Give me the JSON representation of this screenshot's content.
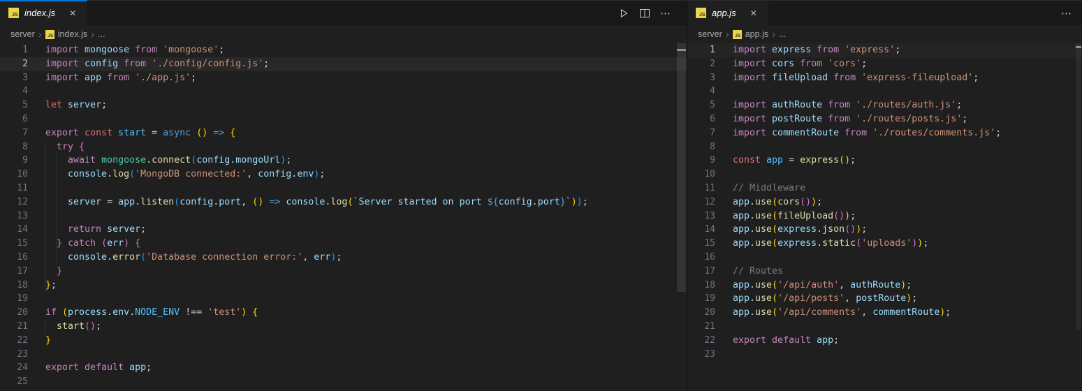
{
  "palette": {
    "kp": "#C586C0",
    "kw": "#569CD6",
    "st": "#E06C75",
    "vr": "#9CDCFE",
    "ct": "#4FC1FF",
    "cl": "#4EC9B0",
    "fn": "#DCDCAA",
    "sr": "#CE9178",
    "ts": "#9CDCFE",
    "te": "#569CD6",
    "cm": "#7B7B7B",
    "pn": "#D4D4D4",
    "b1": "#FFD700",
    "b2": "#DA70D6",
    "b3": "#179FFF"
  },
  "ui": {
    "accent": "#0078D4",
    "editor_bg": "#1F1F1F",
    "tabbar_bg": "#181818",
    "line_highlight_left": "#282828",
    "line_highlight_right": "#242424"
  },
  "icons": {
    "js_badge": "JS",
    "close": "✕",
    "more": "⋯",
    "breadcrumb_sep": "›"
  },
  "left": {
    "tab": {
      "label": "index.js"
    },
    "breadcrumb": [
      {
        "label": "server"
      },
      {
        "label": "index.js",
        "js": true
      },
      {
        "label": "..."
      }
    ],
    "active_line": 2,
    "lines": [
      [
        [
          "kp",
          "import"
        ],
        [
          "vr",
          " mongoose"
        ],
        [
          "kp",
          " from"
        ],
        [
          "sr",
          " 'mongoose'"
        ],
        [
          "pn",
          ";"
        ]
      ],
      [
        [
          "kp",
          "import"
        ],
        [
          "vr",
          " config"
        ],
        [
          "kp",
          " from"
        ],
        [
          "sr",
          " './config/config.js'"
        ],
        [
          "pn",
          ";"
        ]
      ],
      [
        [
          "kp",
          "import"
        ],
        [
          "vr",
          " app"
        ],
        [
          "kp",
          " from"
        ],
        [
          "sr",
          " './app.js'"
        ],
        [
          "pn",
          ";"
        ]
      ],
      [],
      [
        [
          "st",
          "let"
        ],
        [
          "vr",
          " server"
        ],
        [
          "pn",
          ";"
        ]
      ],
      [],
      [
        [
          "kp",
          "export"
        ],
        [
          "st",
          " const"
        ],
        [
          "ct",
          " start"
        ],
        [
          "pn",
          " ="
        ],
        [
          "kw",
          " async"
        ],
        [
          "b1",
          " ()"
        ],
        [
          "kw",
          " =>"
        ],
        [
          "b1",
          " {"
        ]
      ],
      [
        [
          "kp",
          "  try"
        ],
        [
          "b2",
          " {"
        ]
      ],
      [
        [
          "kp",
          "    await"
        ],
        [
          "cl",
          " mongoose"
        ],
        [
          "pn",
          "."
        ],
        [
          "fn",
          "connect"
        ],
        [
          "b3",
          "("
        ],
        [
          "vr",
          "config"
        ],
        [
          "pn",
          "."
        ],
        [
          "vr",
          "mongoUrl"
        ],
        [
          "b3",
          ")"
        ],
        [
          "pn",
          ";"
        ]
      ],
      [
        [
          "vr",
          "    console"
        ],
        [
          "pn",
          "."
        ],
        [
          "fn",
          "log"
        ],
        [
          "b3",
          "("
        ],
        [
          "sr",
          "'MongoDB connected:'"
        ],
        [
          "pn",
          ","
        ],
        [
          "vr",
          " config"
        ],
        [
          "pn",
          "."
        ],
        [
          "vr",
          "env"
        ],
        [
          "b3",
          ")"
        ],
        [
          "pn",
          ";"
        ]
      ],
      [],
      [
        [
          "vr",
          "    server"
        ],
        [
          "pn",
          " ="
        ],
        [
          "vr",
          " app"
        ],
        [
          "pn",
          "."
        ],
        [
          "fn",
          "listen"
        ],
        [
          "b3",
          "("
        ],
        [
          "vr",
          "config"
        ],
        [
          "pn",
          "."
        ],
        [
          "vr",
          "port"
        ],
        [
          "pn",
          ","
        ],
        [
          "b1",
          " ()"
        ],
        [
          "kw",
          " =>"
        ],
        [
          "vr",
          " console"
        ],
        [
          "pn",
          "."
        ],
        [
          "fn",
          "log"
        ],
        [
          "b1",
          "("
        ],
        [
          "ts",
          "`Server started on port "
        ],
        [
          "te",
          "${"
        ],
        [
          "vr",
          "config"
        ],
        [
          "pn",
          "."
        ],
        [
          "vr",
          "port"
        ],
        [
          "te",
          "}"
        ],
        [
          "ts",
          "`"
        ],
        [
          "b1",
          ")"
        ],
        [
          "b3",
          ")"
        ],
        [
          "pn",
          ";"
        ]
      ],
      [],
      [
        [
          "kp",
          "    return"
        ],
        [
          "vr",
          " server"
        ],
        [
          "pn",
          ";"
        ]
      ],
      [
        [
          "b2",
          "  }"
        ],
        [
          "kp",
          " catch"
        ],
        [
          "b2",
          " ("
        ],
        [
          "vr",
          "err"
        ],
        [
          "b2",
          ")"
        ],
        [
          "b2",
          " {"
        ]
      ],
      [
        [
          "vr",
          "    console"
        ],
        [
          "pn",
          "."
        ],
        [
          "fn",
          "error"
        ],
        [
          "b3",
          "("
        ],
        [
          "sr",
          "'Database connection error:'"
        ],
        [
          "pn",
          ","
        ],
        [
          "vr",
          " err"
        ],
        [
          "b3",
          ")"
        ],
        [
          "pn",
          ";"
        ]
      ],
      [
        [
          "b2",
          "  }"
        ]
      ],
      [
        [
          "b1",
          "}"
        ],
        [
          "pn",
          ";"
        ]
      ],
      [],
      [
        [
          "kp",
          "if"
        ],
        [
          "b1",
          " ("
        ],
        [
          "vr",
          "process"
        ],
        [
          "pn",
          "."
        ],
        [
          "vr",
          "env"
        ],
        [
          "pn",
          "."
        ],
        [
          "ct",
          "NODE_ENV"
        ],
        [
          "pn",
          " !=="
        ],
        [
          "sr",
          " 'test'"
        ],
        [
          "b1",
          ")"
        ],
        [
          "b1",
          " {"
        ]
      ],
      [
        [
          "fn",
          "  start"
        ],
        [
          "b2",
          "()"
        ],
        [
          "pn",
          ";"
        ]
      ],
      [
        [
          "b1",
          "}"
        ]
      ],
      [],
      [
        [
          "kp",
          "export"
        ],
        [
          "kp",
          " default"
        ],
        [
          "vr",
          " app"
        ],
        [
          "pn",
          ";"
        ]
      ],
      []
    ]
  },
  "right": {
    "tab": {
      "label": "app.js"
    },
    "breadcrumb": [
      {
        "label": "server"
      },
      {
        "label": "app.js",
        "js": true
      },
      {
        "label": "..."
      }
    ],
    "active_line": 1,
    "lines": [
      [
        [
          "kp",
          "import"
        ],
        [
          "vr",
          " express"
        ],
        [
          "kp",
          " from"
        ],
        [
          "sr",
          " 'express'"
        ],
        [
          "pn",
          ";"
        ]
      ],
      [
        [
          "kp",
          "import"
        ],
        [
          "vr",
          " cors"
        ],
        [
          "kp",
          " from"
        ],
        [
          "sr",
          " 'cors'"
        ],
        [
          "pn",
          ";"
        ]
      ],
      [
        [
          "kp",
          "import"
        ],
        [
          "vr",
          " fileUpload"
        ],
        [
          "kp",
          " from"
        ],
        [
          "sr",
          " 'express-fileupload'"
        ],
        [
          "pn",
          ";"
        ]
      ],
      [],
      [
        [
          "kp",
          "import"
        ],
        [
          "vr",
          " authRoute"
        ],
        [
          "kp",
          " from"
        ],
        [
          "sr",
          " './routes/auth.js'"
        ],
        [
          "pn",
          ";"
        ]
      ],
      [
        [
          "kp",
          "import"
        ],
        [
          "vr",
          " postRoute"
        ],
        [
          "kp",
          " from"
        ],
        [
          "sr",
          " './routes/posts.js'"
        ],
        [
          "pn",
          ";"
        ]
      ],
      [
        [
          "kp",
          "import"
        ],
        [
          "vr",
          " commentRoute"
        ],
        [
          "kp",
          " from"
        ],
        [
          "sr",
          " './routes/comments.js'"
        ],
        [
          "pn",
          ";"
        ]
      ],
      [],
      [
        [
          "st",
          "const"
        ],
        [
          "ct",
          " app"
        ],
        [
          "pn",
          " ="
        ],
        [
          "fn",
          " express"
        ],
        [
          "b1",
          "()"
        ],
        [
          "pn",
          ";"
        ]
      ],
      [],
      [
        [
          "cm",
          "// Middleware"
        ]
      ],
      [
        [
          "vr",
          "app"
        ],
        [
          "pn",
          "."
        ],
        [
          "fn",
          "use"
        ],
        [
          "b1",
          "("
        ],
        [
          "fn",
          "cors"
        ],
        [
          "b2",
          "()"
        ],
        [
          "b1",
          ")"
        ],
        [
          "pn",
          ";"
        ]
      ],
      [
        [
          "vr",
          "app"
        ],
        [
          "pn",
          "."
        ],
        [
          "fn",
          "use"
        ],
        [
          "b1",
          "("
        ],
        [
          "fn",
          "fileUpload"
        ],
        [
          "b2",
          "()"
        ],
        [
          "b1",
          ")"
        ],
        [
          "pn",
          ";"
        ]
      ],
      [
        [
          "vr",
          "app"
        ],
        [
          "pn",
          "."
        ],
        [
          "fn",
          "use"
        ],
        [
          "b1",
          "("
        ],
        [
          "vr",
          "express"
        ],
        [
          "pn",
          "."
        ],
        [
          "fn",
          "json"
        ],
        [
          "b2",
          "()"
        ],
        [
          "b1",
          ")"
        ],
        [
          "pn",
          ";"
        ]
      ],
      [
        [
          "vr",
          "app"
        ],
        [
          "pn",
          "."
        ],
        [
          "fn",
          "use"
        ],
        [
          "b1",
          "("
        ],
        [
          "vr",
          "express"
        ],
        [
          "pn",
          "."
        ],
        [
          "fn",
          "static"
        ],
        [
          "b2",
          "("
        ],
        [
          "sr",
          "'uploads'"
        ],
        [
          "b2",
          ")"
        ],
        [
          "b1",
          ")"
        ],
        [
          "pn",
          ";"
        ]
      ],
      [],
      [
        [
          "cm",
          "// Routes"
        ]
      ],
      [
        [
          "vr",
          "app"
        ],
        [
          "pn",
          "."
        ],
        [
          "fn",
          "use"
        ],
        [
          "b1",
          "("
        ],
        [
          "sr",
          "'/api/auth'"
        ],
        [
          "pn",
          ","
        ],
        [
          "vr",
          " authRoute"
        ],
        [
          "b1",
          ")"
        ],
        [
          "pn",
          ";"
        ]
      ],
      [
        [
          "vr",
          "app"
        ],
        [
          "pn",
          "."
        ],
        [
          "fn",
          "use"
        ],
        [
          "b1",
          "("
        ],
        [
          "sr",
          "'/api/posts'"
        ],
        [
          "pn",
          ","
        ],
        [
          "vr",
          " postRoute"
        ],
        [
          "b1",
          ")"
        ],
        [
          "pn",
          ";"
        ]
      ],
      [
        [
          "vr",
          "app"
        ],
        [
          "pn",
          "."
        ],
        [
          "fn",
          "use"
        ],
        [
          "b1",
          "("
        ],
        [
          "sr",
          "'/api/comments'"
        ],
        [
          "pn",
          ","
        ],
        [
          "vr",
          " commentRoute"
        ],
        [
          "b1",
          ")"
        ],
        [
          "pn",
          ";"
        ]
      ],
      [],
      [
        [
          "kp",
          "export"
        ],
        [
          "kp",
          " default"
        ],
        [
          "vr",
          " app"
        ],
        [
          "pn",
          ";"
        ]
      ],
      []
    ]
  }
}
